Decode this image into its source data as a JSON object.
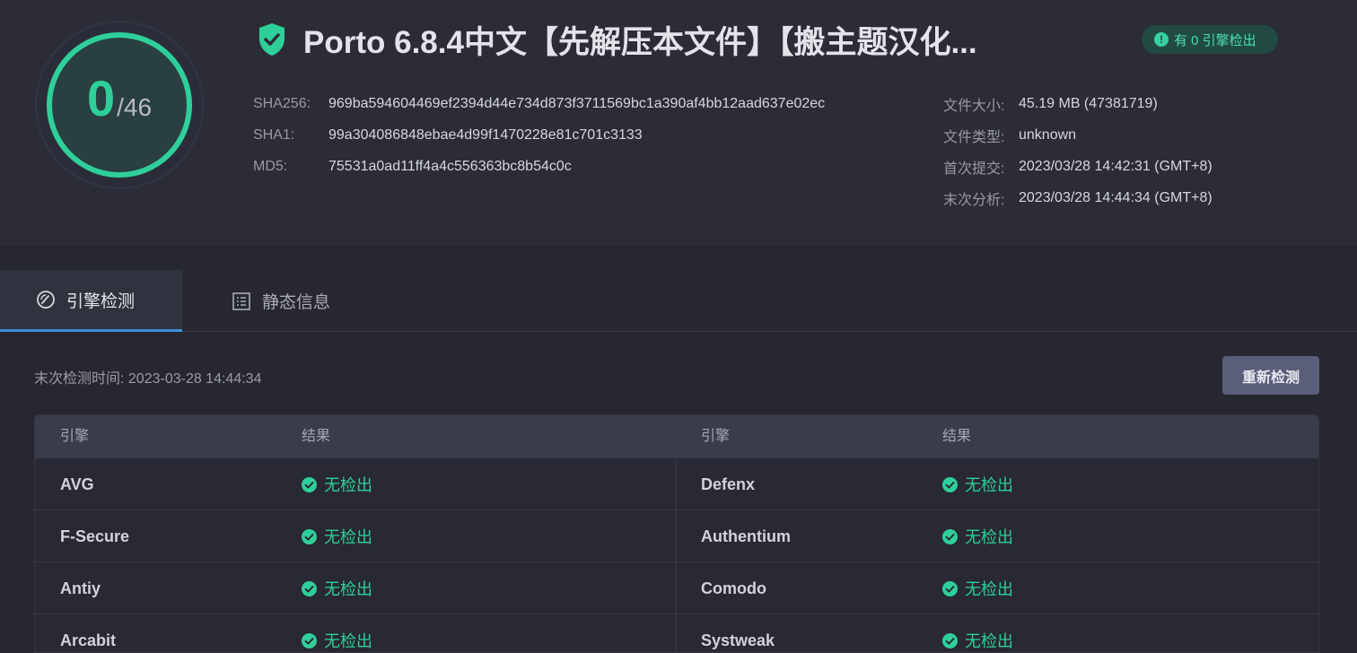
{
  "score": {
    "detected": "0",
    "total": "/46"
  },
  "file": {
    "title": "Porto 6.8.4中文【先解压本文件】【搬主题汉化..."
  },
  "alert": {
    "text": "有 0 引擎检出",
    "icon": "exclamation-icon"
  },
  "hashes": [
    {
      "label": "SHA256:",
      "value": "969ba594604469ef2394d44e734d873f3711569bc1a390af4bb12aad637e02ec"
    },
    {
      "label": "SHA1:",
      "value": "99a304086848ebae4d99f1470228e81c701c3133"
    },
    {
      "label": "MD5:",
      "value": "75531a0ad11ff4a4c556363bc8b54c0c"
    }
  ],
  "meta": [
    {
      "label": "文件大小:",
      "value": "45.19 MB (47381719)"
    },
    {
      "label": "文件类型:",
      "value": "unknown"
    },
    {
      "label": "首次提交:",
      "value": "2023/03/28 14:42:31 (GMT+8)"
    },
    {
      "label": "末次分析:",
      "value": "2023/03/28 14:44:34 (GMT+8)"
    }
  ],
  "tabs": [
    {
      "label": "引擎检测",
      "icon": "gauge-icon"
    },
    {
      "label": "静态信息",
      "icon": "list-icon"
    }
  ],
  "scan": {
    "last_time": "末次检测时间: 2023-03-28 14:44:34",
    "rescan_label": "重新检测"
  },
  "table": {
    "headers": [
      "引擎",
      "结果",
      "引擎",
      "结果"
    ],
    "rows": [
      {
        "left_engine": "AVG",
        "left_result": "无检出",
        "right_engine": "Defenx",
        "right_result": "无检出"
      },
      {
        "left_engine": "F-Secure",
        "left_result": "无检出",
        "right_engine": "Authentium",
        "right_result": "无检出"
      },
      {
        "left_engine": "Antiy",
        "left_result": "无检出",
        "right_engine": "Comodo",
        "right_result": "无检出"
      },
      {
        "left_engine": "Arcabit",
        "left_result": "无检出",
        "right_engine": "Systweak",
        "right_result": "无检出"
      }
    ]
  },
  "colors": {
    "accent_green": "#2fcf9a",
    "tab_underline": "#3d8fd6",
    "button_bg": "#5b5e7a"
  }
}
